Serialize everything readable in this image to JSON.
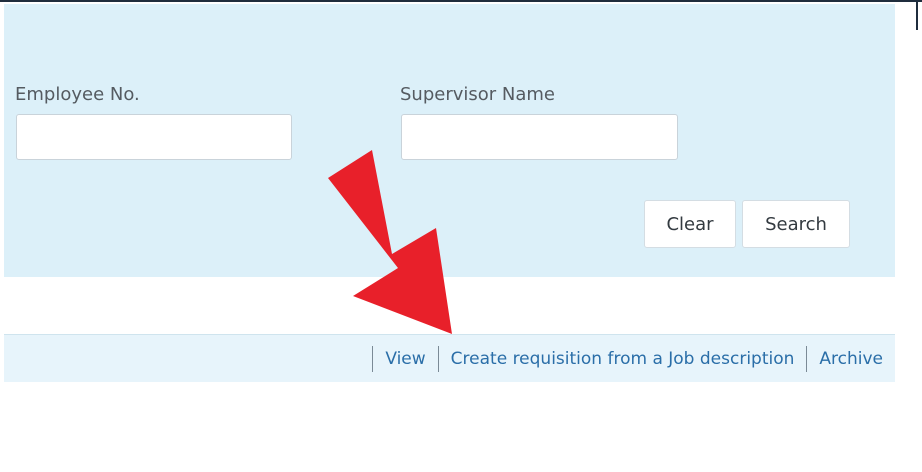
{
  "filters": {
    "employee_no": {
      "label": "Employee No.",
      "value": ""
    },
    "supervisor_name": {
      "label": "Supervisor Name",
      "value": ""
    }
  },
  "buttons": {
    "clear": "Clear",
    "search": "Search"
  },
  "actions": {
    "view": "View",
    "create_requisition": "Create requisition from a Job description",
    "archive": "Archive"
  },
  "colors": {
    "panel_bg": "#dcf0f9",
    "link": "#2a6ea8",
    "arrow": "#e8202a"
  }
}
